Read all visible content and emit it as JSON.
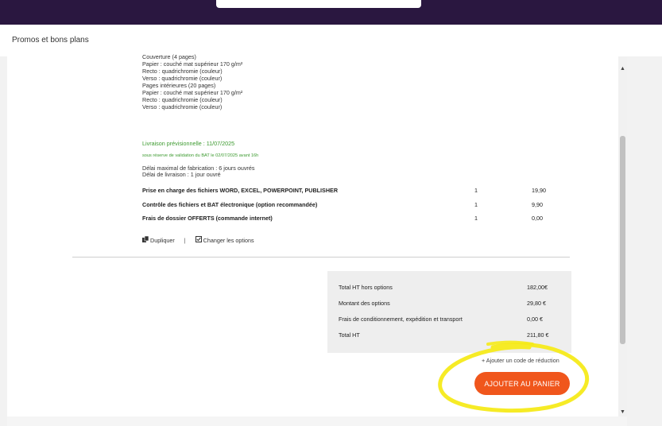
{
  "header": {
    "promos_link": "Promos et bons plans"
  },
  "product": {
    "spec_lines": [
      "Couverture (4 pages)",
      "Papier : couché mat supérieur 170 g/m²",
      "Recto : quadrichromie (couleur)",
      "Verso : quadrichromie (couleur)",
      "Pages intérieures (20 pages)",
      "Papier : couché mat supérieur 170 g/m²",
      "Recto : quadrichromie (couleur)",
      "Verso : quadrichromie (couleur)"
    ],
    "delivery_estimate": "Livraison prévisionnelle : 11/07/2025",
    "bat_note": "sous réserve de validation du BAT le 02/07/2025 avant 16h",
    "fabrication_delay": "Délai maximal de fabrication : 6 jours ouvrés",
    "shipping_delay": "Délai de livraison : 1 jour ouvré"
  },
  "options": [
    {
      "label": "Prise en charge des fichiers WORD, EXCEL, POWERPOINT, PUBLISHER",
      "qty": "1",
      "price": "19,90"
    },
    {
      "label": "Contrôle des fichiers et BAT électronique (option recommandée)",
      "qty": "1",
      "price": "9,90"
    },
    {
      "label": "Frais de dossier OFFERTS (commande internet)",
      "qty": "1",
      "price": "0,00"
    }
  ],
  "actions": {
    "duplicate": "Dupliquer",
    "separator": "|",
    "change_options": "Changer les options"
  },
  "totals": [
    {
      "label": "Total HT hors options",
      "value": "182,00€"
    },
    {
      "label": "Montant des options",
      "value": "29,80 €"
    },
    {
      "label": "Frais de conditionnement, expédition et transport",
      "value": "0,00 €"
    },
    {
      "label": "Total HT",
      "value": "211,80 €"
    }
  ],
  "promo_code_link": "+ Ajouter un code de réduction",
  "cart_button": "AJOUTER AU PANIER",
  "icons": {
    "duplicate": "copy-icon",
    "change_options": "checkbox-edit-icon",
    "scroll_up": "triangle-up-icon",
    "scroll_down": "triangle-down-icon"
  },
  "colors": {
    "topbar": "#2a1740",
    "green_text": "#3c9a2f",
    "cart_button": "#f0561c",
    "highlight_marker": "#f5ea1a",
    "totals_background": "#eeeeee"
  }
}
